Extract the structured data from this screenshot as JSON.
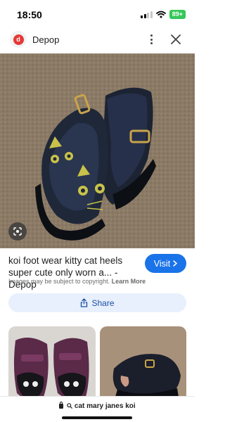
{
  "status": {
    "time": "18:50",
    "battery": "89+"
  },
  "header": {
    "site_name": "Depop",
    "logo_letter": "d"
  },
  "result": {
    "title": "koi foot wear kitty cat heels super cute only worn a... - Depop",
    "visit_label": "Visit",
    "copyright_notice": "Images may be subject to copyright.",
    "learn_more": "Learn More",
    "share_label": "Share"
  },
  "search": {
    "query": "cat mary janes koi"
  },
  "colors": {
    "accent": "#1a73e8",
    "share_bg": "#e8f0fe",
    "logo_red": "#e53935"
  },
  "icons": [
    "signal-icon",
    "wifi-icon",
    "battery-icon",
    "more-vert-icon",
    "close-icon",
    "lens-icon",
    "chevron-right-icon",
    "share-icon",
    "lock-icon",
    "search-icon"
  ]
}
